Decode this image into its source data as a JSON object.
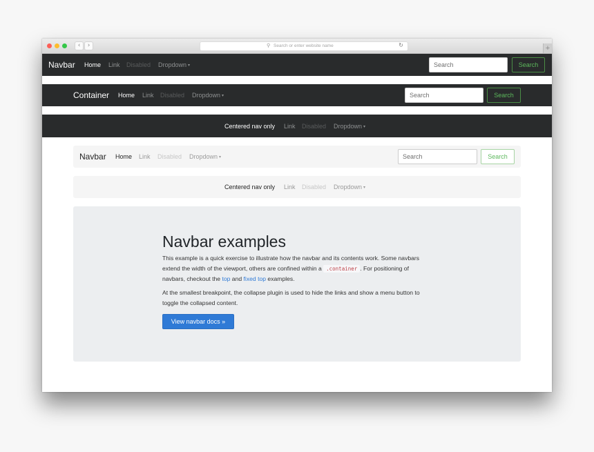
{
  "browser": {
    "back_icon": "‹",
    "forward_icon": "›",
    "search_icon": "⚲",
    "address_placeholder": "Search or enter website name",
    "reload_icon": "↻",
    "new_tab_icon": "+"
  },
  "navbar1": {
    "brand": "Navbar",
    "links": [
      {
        "label": "Home",
        "state": "active"
      },
      {
        "label": "Link",
        "state": "normal"
      },
      {
        "label": "Disabled",
        "state": "disabled"
      },
      {
        "label": "Dropdown",
        "state": "normal"
      }
    ],
    "caret": "▾",
    "search_placeholder": "Search",
    "search_button": "Search"
  },
  "navbar2": {
    "brand": "Container",
    "links": [
      {
        "label": "Home",
        "state": "active"
      },
      {
        "label": "Link",
        "state": "normal"
      },
      {
        "label": "Disabled",
        "state": "disabled"
      },
      {
        "label": "Dropdown",
        "state": "normal"
      }
    ],
    "caret": "▾",
    "search_placeholder": "Search",
    "search_button": "Search"
  },
  "navbar3": {
    "links": [
      {
        "label": "Centered nav only",
        "state": "active"
      },
      {
        "label": "Link",
        "state": "normal"
      },
      {
        "label": "Disabled",
        "state": "disabled"
      },
      {
        "label": "Dropdown",
        "state": "normal"
      }
    ],
    "caret": "▾"
  },
  "navbar4": {
    "brand": "Navbar",
    "links": [
      {
        "label": "Home",
        "state": "active"
      },
      {
        "label": "Link",
        "state": "normal"
      },
      {
        "label": "Disabled",
        "state": "disabled"
      },
      {
        "label": "Dropdown",
        "state": "normal"
      }
    ],
    "caret": "▾",
    "search_placeholder": "Search",
    "search_button": "Search"
  },
  "navbar5": {
    "links": [
      {
        "label": "Centered nav only",
        "state": "active"
      },
      {
        "label": "Link",
        "state": "normal"
      },
      {
        "label": "Disabled",
        "state": "disabled"
      },
      {
        "label": "Dropdown",
        "state": "normal"
      }
    ],
    "caret": "▾"
  },
  "jumbotron": {
    "title": "Navbar examples",
    "p1_part1": "This example is a quick exercise to illustrate how the navbar and its contents work. Some navbars extend the width of the viewport, others are confined within a ",
    "p1_code": ".container",
    "p1_part2": ". For positioning of navbars, checkout the ",
    "p1_link1": "top",
    "p1_part3": " and ",
    "p1_link2": "fixed top",
    "p1_part4": " examples.",
    "p2": "At the smallest breakpoint, the collapse plugin is used to hide the links and show a menu button to toggle the collapsed content.",
    "button": "View navbar docs »"
  },
  "colors": {
    "dark_navbar": "#292b2c",
    "light_navbar": "#f5f5f5",
    "success": "#5cb85c",
    "primary": "#2f7ad6",
    "jumbotron_bg": "#eceef0",
    "code": "#bd4147"
  }
}
